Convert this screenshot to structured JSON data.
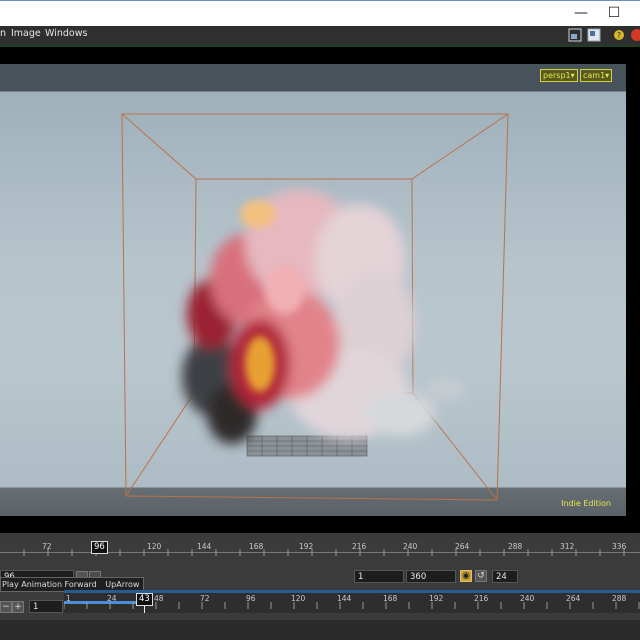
{
  "window": {
    "minimize_glyph": "—",
    "maximize_glyph": "☐"
  },
  "menubar": {
    "items": [
      "n",
      "Image",
      "Windows"
    ],
    "icons": [
      "layout-icon",
      "pane-icon",
      "help-icon",
      "close-red-icon"
    ]
  },
  "viewport": {
    "camera_menu": "persp1▾",
    "cam_menu": "cam1▾",
    "watermark": "Indie Edition",
    "colors": {
      "box": "#b8734a",
      "bg_top": "#9fb0bb",
      "bg_bottom": "#adbcc5",
      "tag": "#e5e84a"
    }
  },
  "timeline": {
    "upper_ruler": {
      "labels": [
        "72",
        "96",
        "120",
        "144",
        "168",
        "192",
        "216",
        "240",
        "264",
        "288",
        "312",
        "336"
      ],
      "current": "96"
    },
    "start_field": "1",
    "end_field": "360",
    "fps_field": "24",
    "left_field": "96",
    "tooltip": {
      "text": "Play Animation Forward",
      "shortcut": "UpArrow"
    },
    "lower_ruler": {
      "labels": [
        "1",
        "24",
        "48",
        "72",
        "96",
        "120",
        "144",
        "168",
        "192",
        "216",
        "240",
        "264",
        "288"
      ],
      "current": "43",
      "start_field": "1"
    },
    "accent": "#4a90d9"
  }
}
